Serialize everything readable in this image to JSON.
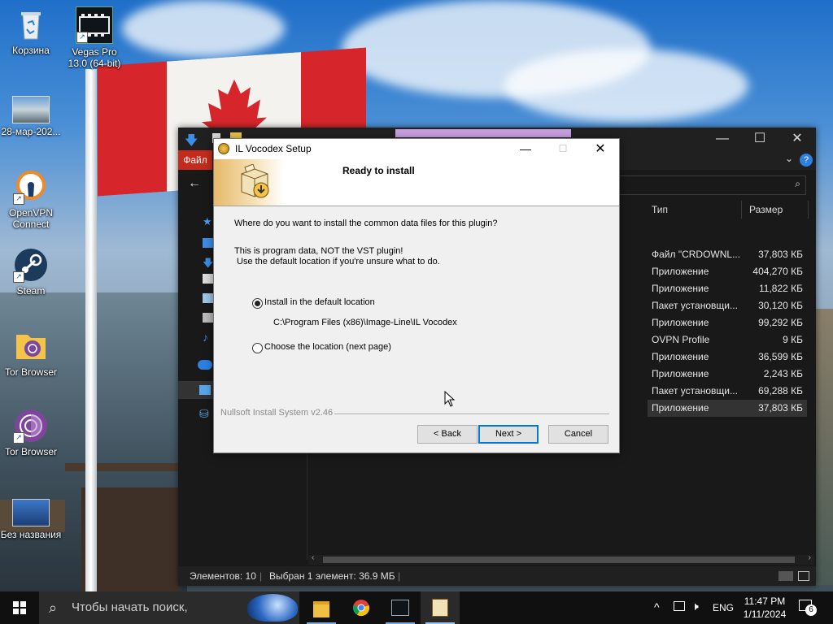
{
  "desktop": {
    "icons": [
      {
        "label": "Корзина"
      },
      {
        "label": "Vegas Pro 13.0 (64-bit)",
        "label_line1": "Vegas Pro",
        "label_line2": "13.0 (64-bit)"
      },
      {
        "label": "28-мар-202..."
      },
      {
        "label": "OpenVPN Connect",
        "label_line1": "OpenVPN",
        "label_line2": "Connect"
      },
      {
        "label": "Steam"
      },
      {
        "label": "Tor Browser"
      },
      {
        "label": "Tor Browser"
      },
      {
        "label": "Без названия"
      }
    ]
  },
  "explorer": {
    "ribbon_file": "Файл",
    "columns": {
      "type": "Тип",
      "size": "Размер"
    },
    "rows": [
      {
        "type": "Файл \"CRDOWNL...",
        "size": "37,803 КБ"
      },
      {
        "type": "Приложение",
        "size": "404,270 КБ"
      },
      {
        "type": "Приложение",
        "size": "11,822 КБ"
      },
      {
        "type": "Пакет установщи...",
        "size": "30,120 КБ"
      },
      {
        "type": "Приложение",
        "size": "99,292 КБ"
      },
      {
        "type": "OVPN Profile",
        "size": "9 КБ"
      },
      {
        "type": "Приложение",
        "size": "36,599 КБ"
      },
      {
        "type": "Приложение",
        "size": "2,243 КБ"
      },
      {
        "type": "Пакет установщи...",
        "size": "69,288 КБ"
      },
      {
        "type": "Приложение",
        "size": "37,803 КБ"
      }
    ],
    "status": {
      "items": "Элементов: 10",
      "selected": "Выбран 1 элемент: 36.9 МБ"
    }
  },
  "dialog": {
    "title": "IL Vocodex Setup",
    "header_title": "Ready to install",
    "question": "Where do you want to install the common data files for this plugin?",
    "note_line1": "This is program data, NOT the VST plugin!",
    "note_line2": "Use the default location if you're unsure what to do.",
    "option_default": "Install in the default location",
    "default_path": "C:\\Program Files (x86)\\Image-Line\\IL Vocodex",
    "option_choose": "Choose the location (next page)",
    "branding": "Nullsoft Install System v2.46",
    "buttons": {
      "back": "< Back",
      "next": "Next >",
      "cancel": "Cancel"
    },
    "selected_option": "default"
  },
  "taskbar": {
    "search_placeholder": "Чтобы начать поиск,",
    "language": "ENG",
    "time": "11:47 PM",
    "date": "1/11/2024",
    "notifications": "6"
  },
  "colors": {
    "accent": "#0078d7",
    "ribbon_file": "#c42b1c",
    "explorer_bg": "#191919",
    "taskbar_bg": "#101010"
  }
}
